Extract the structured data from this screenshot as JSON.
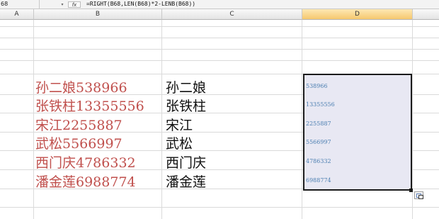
{
  "formula_bar": {
    "name_box": "68",
    "fx_label": "fx",
    "formula": "=RIGHT(B68,LEN(B68)*2-LENB(B68))"
  },
  "columns": [
    "A",
    "B",
    "C",
    "D"
  ],
  "rows": [
    {
      "b": "孙二娘538966",
      "c": "孙二娘",
      "d": "538966"
    },
    {
      "b": "张铁柱13355556",
      "c": "张铁柱",
      "d": "13355556"
    },
    {
      "b": "宋江2255887",
      "c": "宋江",
      "d": "2255887"
    },
    {
      "b": "武松5566997",
      "c": "武松",
      "d": "5566997"
    },
    {
      "b": "西门庆4786332",
      "c": "西门庆",
      "d": "4786332"
    },
    {
      "b": "潘金莲6988774",
      "c": "潘金莲",
      "d": "6988774"
    }
  ],
  "colors": {
    "b_text": "#c0504d",
    "d_text": "#4c7fb1",
    "selection_fill": "#e8e8f3",
    "active_header": "#f6c86e"
  }
}
